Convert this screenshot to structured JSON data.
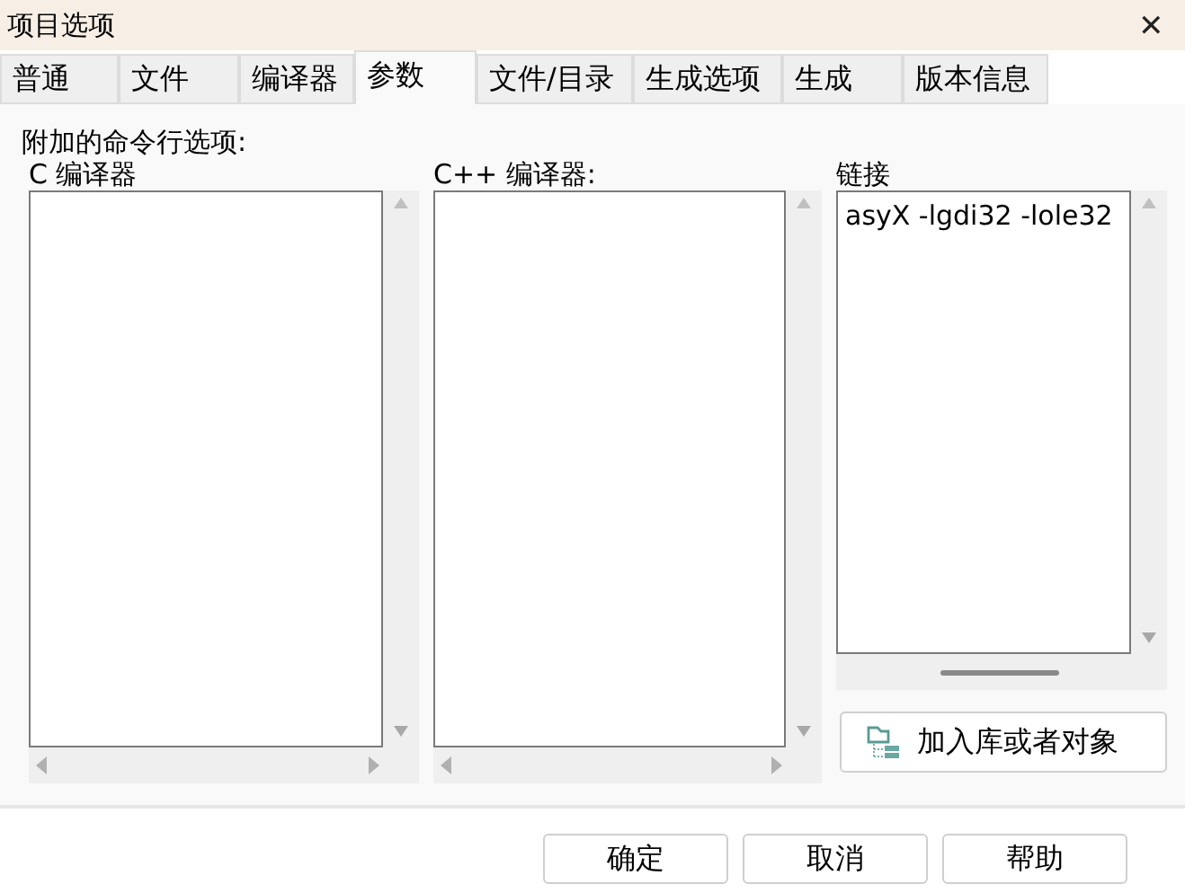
{
  "window": {
    "title": "项目选项",
    "close": "✕"
  },
  "tabs": [
    {
      "label": "普通",
      "selected": false
    },
    {
      "label": "文件",
      "selected": false
    },
    {
      "label": "编译器",
      "selected": false
    },
    {
      "label": "参数",
      "selected": true
    },
    {
      "label": "文件/目录",
      "selected": false
    },
    {
      "label": "生成选项",
      "selected": false
    },
    {
      "label": "生成",
      "selected": false
    },
    {
      "label": "版本信息",
      "selected": false
    }
  ],
  "section_label": "附加的命令行选项:",
  "columns": [
    {
      "label": "C 编译器"
    },
    {
      "label": "C++ 编译器:"
    },
    {
      "label": "链接",
      "value": "asyX -lgdi32 -lole32"
    }
  ],
  "add_library_button": "加入库或者对象",
  "buttons": [
    "确定",
    "取消",
    "帮助"
  ]
}
